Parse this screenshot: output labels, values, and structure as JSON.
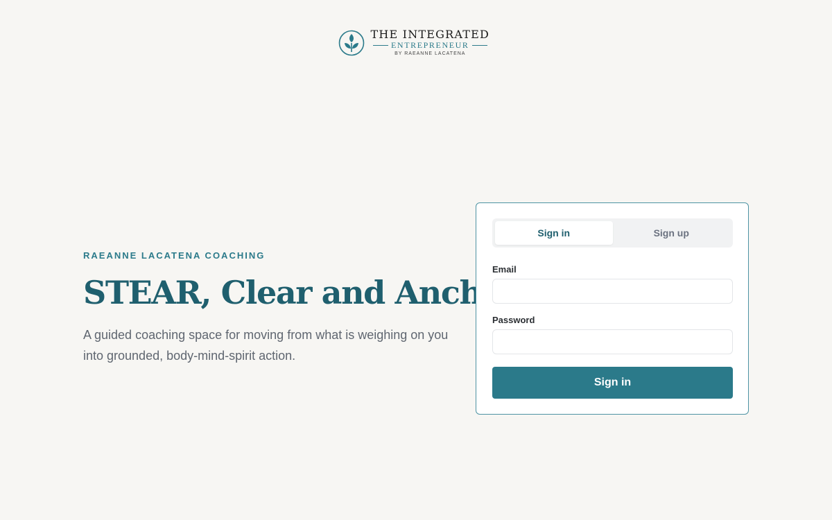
{
  "logo": {
    "line1": "THE INTEGRATED",
    "line2": "ENTREPRENEUR",
    "line3": "BY RAEANNE LACATENA",
    "icon": "leaf-sprout-icon",
    "brand_color": "#2b7a8a"
  },
  "hero": {
    "eyebrow": "RAEANNE LACATENA COACHING",
    "headline": "STEAR, Clear and Anchor",
    "lede": "A guided coaching space for moving from what is weighing on you into grounded, body-mind-spirit action.",
    "headline_color": "#1f5f6e"
  },
  "auth": {
    "tabs": [
      {
        "label": "Sign in",
        "active": true
      },
      {
        "label": "Sign up",
        "active": false
      }
    ],
    "email": {
      "label": "Email",
      "value": "",
      "placeholder": ""
    },
    "password": {
      "label": "Password",
      "value": "",
      "placeholder": ""
    },
    "submit_label": "Sign in",
    "accent_color": "#2b7a8a"
  }
}
